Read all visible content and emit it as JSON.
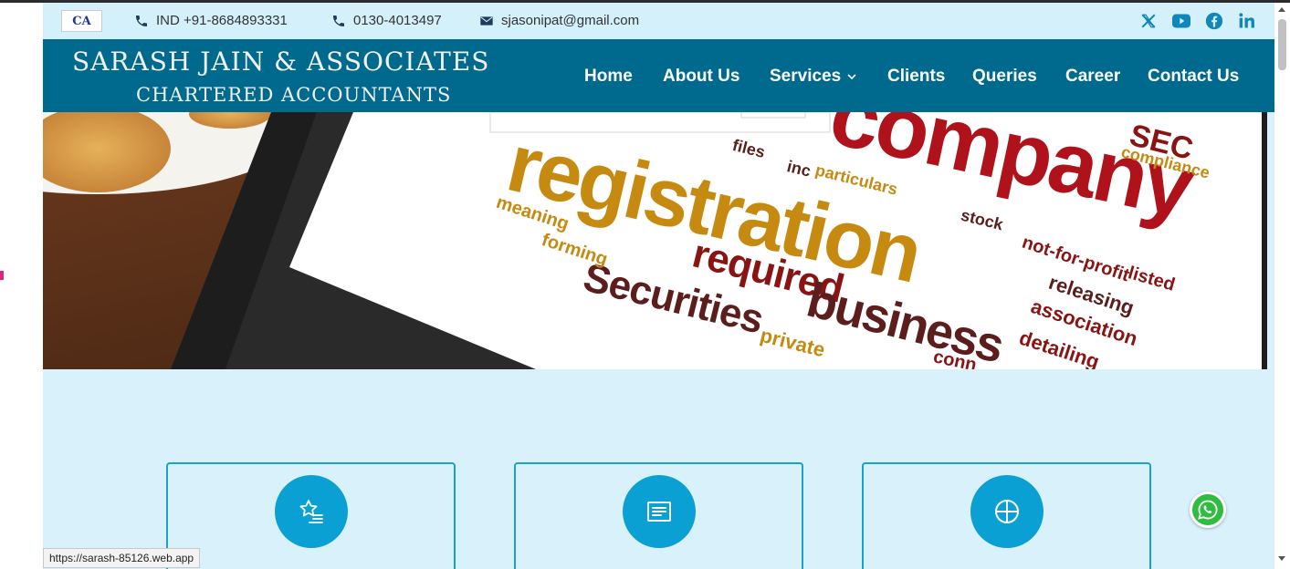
{
  "topbar": {
    "logo_text": "CA",
    "phone_mobile": "IND +91-8684893331",
    "phone_landline": "0130-4013497",
    "email": "sjasonipat@gmail.com",
    "social_icons": [
      "x-icon",
      "youtube-icon",
      "facebook-icon",
      "linkedin-icon"
    ]
  },
  "brand": {
    "line1": "SARASH JAIN & ASSOCIATES",
    "line2": "CHARTERED ACCOUNTANTS"
  },
  "nav": {
    "home": "Home",
    "about": "About Us",
    "services": "Services",
    "clients": "Clients",
    "queries": "Queries",
    "career": "Career",
    "contact": "Contact Us"
  },
  "hero": {
    "words": [
      "company",
      "registration",
      "Securities",
      "required",
      "business",
      "files",
      "inc",
      "particulars",
      "stock",
      "SEC",
      "compliance",
      "not-for-profit",
      "listed",
      "releasing",
      "association",
      "detailing",
      "meaning",
      "forming",
      "private",
      "conn"
    ]
  },
  "cards": [
    {
      "icon": "star-list-icon"
    },
    {
      "icon": "document-icon"
    },
    {
      "icon": "crosshair-globe-icon"
    }
  ],
  "status_bar": {
    "url": "https://sarash-85126.web.app"
  },
  "colors": {
    "topbar_bg": "#d4f0fb",
    "navbar_bg": "#006a8e",
    "accent": "#0aa0d4",
    "section_bg": "#d9f1fb",
    "whatsapp": "#2fbd3f"
  }
}
